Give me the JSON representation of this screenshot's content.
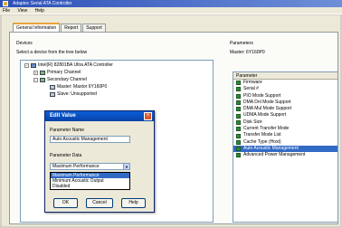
{
  "window": {
    "title": "Adaptec Serial ATA Controller"
  },
  "menu": [
    "File",
    "View",
    "Help"
  ],
  "tabs": [
    "General Information",
    "Report",
    "Support"
  ],
  "devices": {
    "group_label": "Devices",
    "instruction": "Select a device from the tree below",
    "tree": [
      "Intel(R) 82801BA Ultra ATA Controller",
      "Primary Channel",
      "Secondary Channel",
      "Master: Maxtor 6Y160P0",
      "Slave: Unsupported"
    ]
  },
  "parameters": {
    "group_label": "Parameters",
    "device": "Master: 6Y160P0",
    "column_header": "Parameter",
    "items": [
      "Firmware",
      "Serial #",
      "PIO Mode Support",
      "DMA Dnl Mode Support",
      "DMA Mul Mode Support",
      "UDMA Mode Support",
      "Disk Size",
      "Current Transfer Mode",
      "Transfer Mode List",
      "Cache Type (Host)",
      "Auto Acoustic Management",
      "Advanced Power Management"
    ],
    "selected_index": 10
  },
  "dialog": {
    "title": "Edit Value",
    "param_name_label": "Parameter Name",
    "param_name_value": "Auto Acoustic Management",
    "param_data_label": "Parameter Data",
    "selected_value": "Maximum Performance",
    "options": [
      "Maximum Performance",
      "Minimum Acoustic Output",
      "Disabled"
    ],
    "highlighted_option": 0,
    "ok_label": "OK",
    "cancel_label": "Cancel",
    "help_label": "Help"
  }
}
